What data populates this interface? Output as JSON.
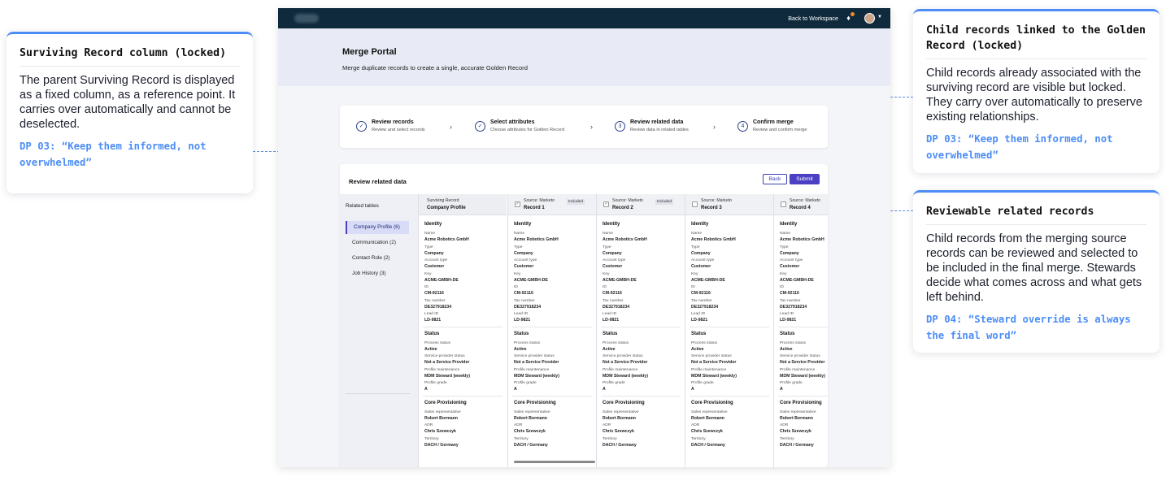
{
  "annotations": {
    "surviving": {
      "title": "Surviving Record column (locked)",
      "body": "The parent Surviving Record is displayed as a fixed column, as a reference point. It carries over automatically and cannot be deselected.",
      "dp": "DP 03: “Keep them informed, not overwhelmed”"
    },
    "child_locked": {
      "title": "Child records linked to the Golden Record (locked)",
      "body": "Child records already associated with the surviving record are visible but locked. They carry over automatically to preserve existing relationships.",
      "dp": "DP 03: “Keep them informed, not overwhelmed”"
    },
    "reviewable": {
      "title": "Reviewable related records",
      "body": "Child records from the merging source records can be reviewed and selected to be included in the final merge. Stewards decide what comes across and what gets left behind.",
      "dp": "DP 04: “Steward override is always the final word”"
    },
    "accent_color": "#4c8df5"
  },
  "app": {
    "topbar": {
      "back_to_workspace": "Back to Workspace",
      "bell_icon": "bell-icon",
      "avatar_icon": "avatar"
    },
    "header": {
      "title": "Merge Portal",
      "subtitle": "Merge duplicate records to create a single, accurate Golden Record"
    },
    "steps": [
      {
        "num": "✓",
        "title": "Review records",
        "sub": "Review and select records"
      },
      {
        "num": "✓",
        "title": "Select attributes",
        "sub": "Choose attributes for Golden Record"
      },
      {
        "num": "3",
        "title": "Review related data",
        "sub": "Review data in related tables"
      },
      {
        "num": "4",
        "title": "Confirm merge",
        "sub": "Review and confirm merge"
      }
    ],
    "panel": {
      "title": "Review related data",
      "back_label": "Back",
      "submit_label": "Submit",
      "related_tables_label": "Related tables",
      "tables": [
        "Company Profile (6)",
        "Communication (2)",
        "Contact Role (2)",
        "Job History (3)"
      ]
    },
    "columns": [
      {
        "source": "Surviving Record",
        "record": "Company Profile",
        "badge": ""
      },
      {
        "source": "Source: Marketo",
        "record": "Record 1",
        "badge": "Included"
      },
      {
        "source": "Source: Marketo",
        "record": "Record 2",
        "badge": "Included"
      },
      {
        "source": "Source: Marketo",
        "record": "Record 3",
        "badge": ""
      },
      {
        "source": "Source: Marketo",
        "record": "Record 4",
        "badge": ""
      }
    ],
    "section_titles": {
      "identity": "Identity",
      "status": "Status",
      "core": "Core Provisioning"
    },
    "fields": {
      "name_label": "Name",
      "name": "Acme Robotics GmbH",
      "type_label": "Type",
      "type": "Company",
      "account_label": "Account type",
      "account": "Customer",
      "key_label": "Key",
      "key": "ACME-GMBH-DE",
      "id_label": "ID",
      "id": "CM-92116",
      "tax_label": "Tax number",
      "tax": "DE327918234",
      "lead_label": "Lead ID",
      "lead": "LD-9821",
      "process_label": "Process status",
      "process": "Active",
      "provider_label": "Service provider status",
      "provider": "Not a Service Provider",
      "maint_label": "Profile maintenance",
      "maint": "MDM Steward (weekly)",
      "grade_label": "Profile grade",
      "grade": "A",
      "sales_label": "Sales representative",
      "sales": "Robert Bormann",
      "adr_label": "ADR",
      "adr": "Chris Szewczyk",
      "territory_label": "Territory",
      "territory": "DACH / Germany"
    }
  }
}
